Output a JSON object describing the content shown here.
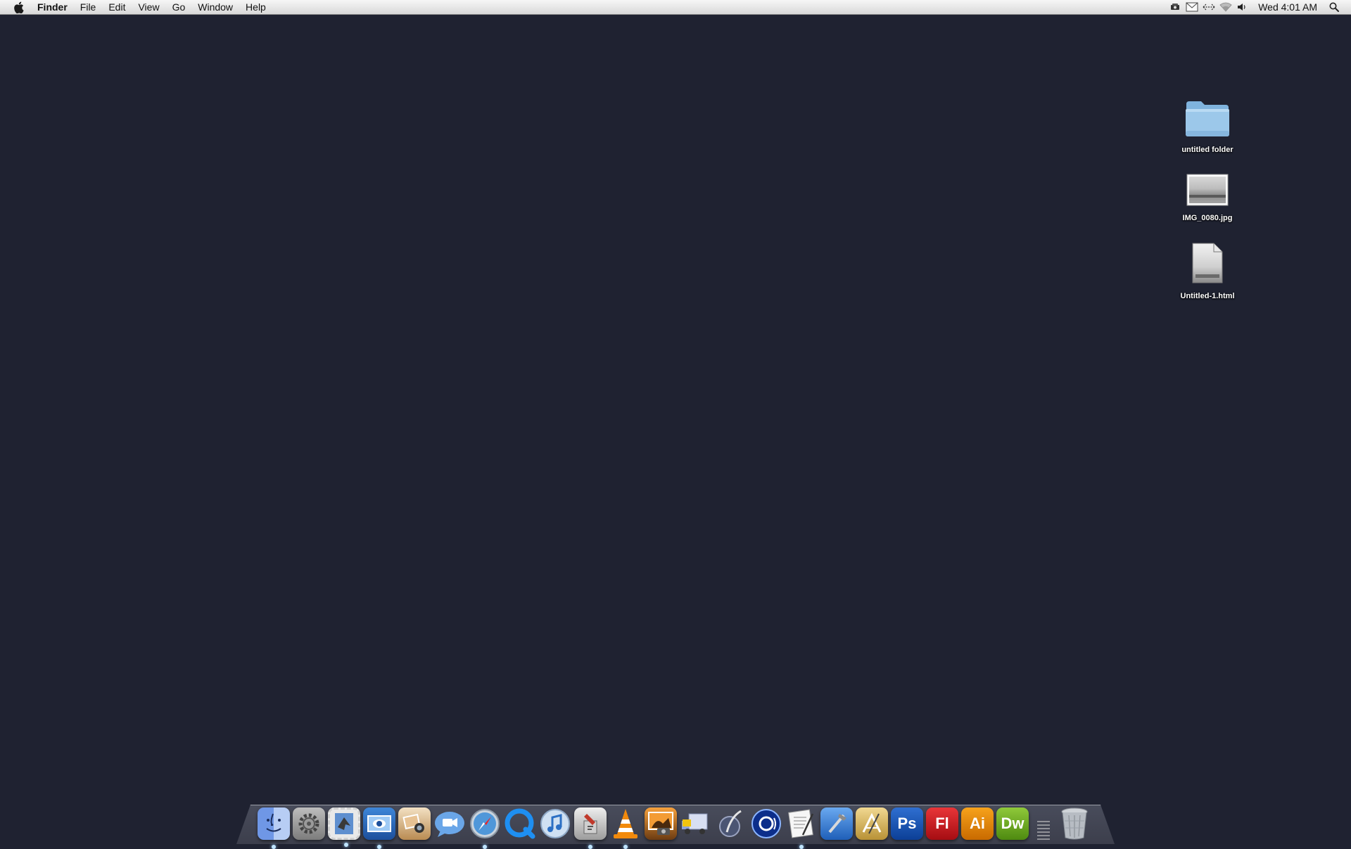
{
  "menubar": {
    "apple_menu": "apple-logo-icon",
    "app_name": "Finder",
    "items": [
      "File",
      "Edit",
      "View",
      "Go",
      "Window",
      "Help"
    ],
    "status_icons": [
      "time-machine-icon",
      "mail-icon",
      "sync-arrows-icon",
      "wifi-icon",
      "volume-icon"
    ],
    "clock": "Wed 4:01 AM",
    "spotlight": "spotlight-search-icon"
  },
  "desktop": {
    "background_color": "#1f2231",
    "icons": [
      {
        "label": "untitled folder",
        "kind": "folder-icon"
      },
      {
        "label": "IMG_0080.jpg",
        "kind": "image-file-icon"
      },
      {
        "label": "Untitled-1.html",
        "kind": "html-file-icon"
      }
    ]
  },
  "dock": {
    "apps": [
      {
        "name": "finder-icon",
        "running": true
      },
      {
        "name": "system-preferences-icon",
        "running": false
      },
      {
        "name": "mail-stamp-icon",
        "running": true
      },
      {
        "name": "preview-icon",
        "running": true
      },
      {
        "name": "image-capture-icon",
        "running": false
      },
      {
        "name": "ichat-icon",
        "running": false
      },
      {
        "name": "safari-icon",
        "running": true
      },
      {
        "name": "quicktime-icon",
        "running": false
      },
      {
        "name": "itunes-icon",
        "running": false
      },
      {
        "name": "script-editor-icon",
        "running": true
      },
      {
        "name": "vlc-icon",
        "running": true
      },
      {
        "name": "iphoto-icon",
        "running": false
      },
      {
        "name": "delivery-truck-icon",
        "running": false
      },
      {
        "name": "quill-pen-icon",
        "running": false
      },
      {
        "name": "audio-app-icon",
        "running": false
      },
      {
        "name": "textedit-icon",
        "running": true
      },
      {
        "name": "xcode-icon",
        "running": false
      },
      {
        "name": "design-tools-icon",
        "running": false
      },
      {
        "name": "photoshop-icon",
        "label": "Ps",
        "running": false
      },
      {
        "name": "flash-icon",
        "label": "Fl",
        "running": false
      },
      {
        "name": "illustrator-icon",
        "label": "Ai",
        "running": false
      },
      {
        "name": "dreamweaver-icon",
        "label": "Dw",
        "running": false
      }
    ],
    "trash": "trash-icon"
  }
}
